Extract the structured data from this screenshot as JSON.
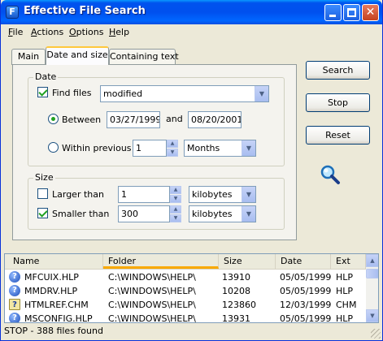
{
  "window": {
    "title": "Effective File Search",
    "icon": "app-icon",
    "icon_glyph": "F"
  },
  "menu": {
    "file": "File",
    "actions": "Actions",
    "options": "Options",
    "help": "Help"
  },
  "tabs": {
    "main": "Main",
    "date_and_size": "Date and size",
    "containing_text": "Containing text",
    "active": "Date and size"
  },
  "date_group": {
    "label": "Date",
    "find_files_label": "Find files",
    "find_files_checked": true,
    "find_files_mode": "modified",
    "between_label": "Between",
    "between_selected": true,
    "start_date": "03/27/1999",
    "and_label": "and",
    "end_date": "08/20/2001",
    "within_label": "Within previous",
    "within_selected": false,
    "within_value": "1",
    "within_unit": "Months"
  },
  "size_group": {
    "label": "Size",
    "larger_label": "Larger than",
    "larger_checked": false,
    "larger_value": "1",
    "larger_unit": "kilobytes",
    "smaller_label": "Smaller than",
    "smaller_checked": true,
    "smaller_value": "300",
    "smaller_unit": "kilobytes"
  },
  "buttons": {
    "search": "Search",
    "stop": "Stop",
    "reset": "Reset"
  },
  "results": {
    "columns": {
      "name": "Name",
      "folder": "Folder",
      "size": "Size",
      "date": "Date",
      "ext": "Ext"
    },
    "sorted_by": "Folder",
    "rows": [
      {
        "name": "MFCUIX.HLP",
        "folder": "C:\\WINDOWS\\HELP\\",
        "size": "13910",
        "date": "05/05/1999",
        "ext": "HLP",
        "icon": "help-file-icon"
      },
      {
        "name": "MMDRV.HLP",
        "folder": "C:\\WINDOWS\\HELP\\",
        "size": "10208",
        "date": "05/05/1999",
        "ext": "HLP",
        "icon": "help-file-icon"
      },
      {
        "name": "HTMLREF.CHM",
        "folder": "C:\\WINDOWS\\HELP\\",
        "size": "123860",
        "date": "12/03/1999",
        "ext": "CHM",
        "icon": "chm-file-icon"
      },
      {
        "name": "MSCONFIG.HLP",
        "folder": "C:\\WINDOWS\\HELP\\",
        "size": "13931",
        "date": "05/05/1999",
        "ext": "HLP",
        "icon": "help-file-icon"
      }
    ]
  },
  "status": "STOP - 388 files found",
  "colors": {
    "title_bar": "#0053ee",
    "window_bg": "#ece9d8",
    "tab_accent": "#ffc83c",
    "check_green": "#21a121"
  }
}
